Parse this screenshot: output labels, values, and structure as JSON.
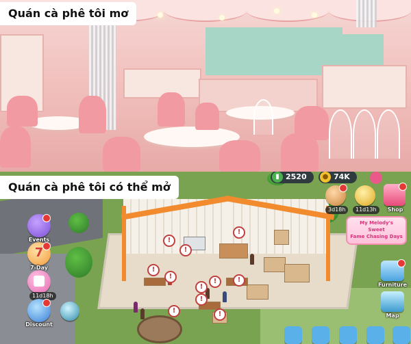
{
  "captions": {
    "dream": "Quán cà phê tôi mơ",
    "actual": "Quán cà phê tôi có thể mở"
  },
  "game": {
    "resources": {
      "cash": "2520",
      "coins": "74K"
    },
    "left_menu": [
      {
        "label": "Events",
        "icon": "events-icon"
      },
      {
        "label": "7-Day",
        "icon": "calendar-icon",
        "number": "7"
      },
      {
        "label": "11d18h",
        "icon": "gift-icon"
      },
      {
        "label": "Discount",
        "icon": "discount-icon"
      }
    ],
    "right_menu": [
      {
        "label": "3d18h",
        "icon": "box-icon"
      },
      {
        "label": "11d13h",
        "icon": "chest-icon"
      },
      {
        "label": "Shop",
        "icon": "shop-icon"
      },
      {
        "label": "Furniture",
        "icon": "furniture-icon"
      },
      {
        "label": "Map",
        "icon": "map-icon"
      }
    ],
    "event_banner": {
      "line1": "My Melody's",
      "line2": "Sweet",
      "line3": "Fame Chasing Days"
    },
    "colors": {
      "grass": "#7aa351",
      "roof": "#f28a2e",
      "floor": "#e7dcc9",
      "resource_bar": "#2f3b3f"
    }
  }
}
